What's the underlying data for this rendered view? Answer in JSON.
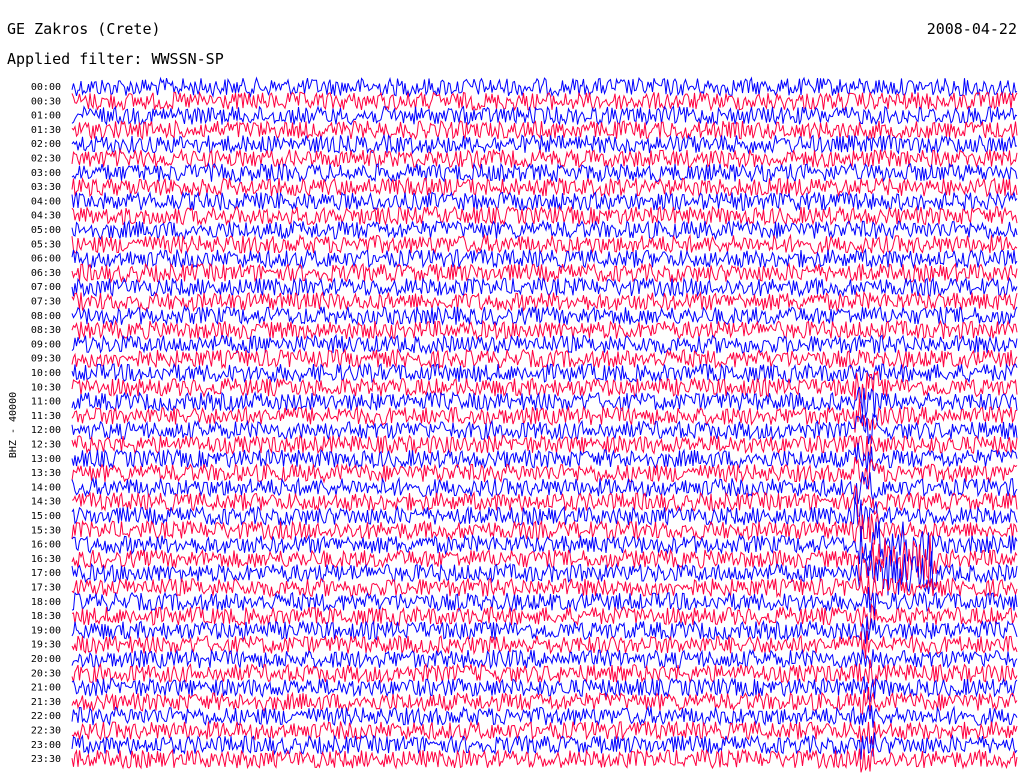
{
  "header": {
    "station": "GE Zakros (Crete)",
    "date": "2008-04-22",
    "filter_text": "Applied filter: WWSSN-SP"
  },
  "colors": {
    "trace_a": "#0000ff",
    "trace_b": "#ff0040",
    "background": "#ffffff"
  },
  "chart_data": {
    "type": "line",
    "title": "GE Zakros (Crete)",
    "subtitle": "Applied filter: WWSSN-SP",
    "ylabel": "BHZ - 40000",
    "xlabel": "",
    "tick_labels": [
      "00:00",
      "00:30",
      "01:00",
      "01:30",
      "02:00",
      "02:30",
      "03:00",
      "03:30",
      "04:00",
      "04:30",
      "05:00",
      "05:30",
      "06:00",
      "06:30",
      "07:00",
      "07:30",
      "08:00",
      "08:30",
      "09:00",
      "09:30",
      "10:00",
      "10:30",
      "11:00",
      "11:30",
      "12:00",
      "12:30",
      "13:00",
      "13:30",
      "14:00",
      "14:30",
      "15:00",
      "15:30",
      "16:00",
      "16:30",
      "17:00",
      "17:30",
      "18:00",
      "18:30",
      "19:00",
      "19:30",
      "20:00",
      "20:30",
      "21:00",
      "21:30",
      "22:00",
      "22:30",
      "23:00",
      "23:30"
    ],
    "trace_colors_alternating": [
      "blue",
      "red"
    ],
    "event": {
      "row_start": "10:30",
      "row_peak": "16:30",
      "x_fraction_of_row": 0.84
    },
    "grid": false
  }
}
